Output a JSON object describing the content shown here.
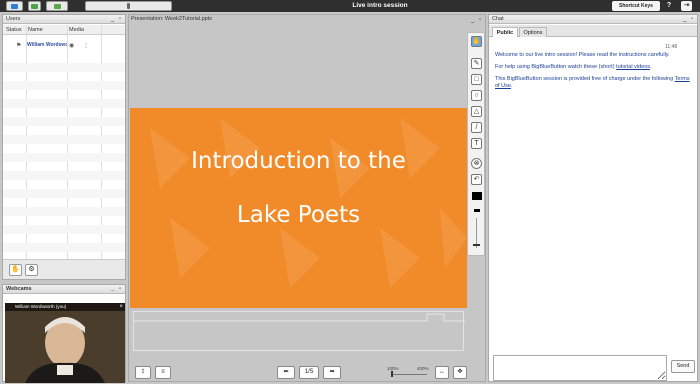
{
  "topbar": {
    "title": "Live intro session",
    "shortcut_label": "Shortcut Keys",
    "help_label": "?",
    "logout_label": "⇥"
  },
  "users": {
    "title": "Users",
    "columns": [
      "Status",
      "Name",
      "Media"
    ],
    "rows": [
      {
        "name": "William Wordsworth"
      }
    ]
  },
  "webcams": {
    "title": "Webcams",
    "caption": "William Wordsworth (you)"
  },
  "presentation": {
    "title": "Presentation: Week2Tutorial.pptx",
    "slide_line1": "Introduction to  the",
    "slide_line2": "Lake Poets",
    "page_indicator": "1/5",
    "zoom_min": "100%",
    "zoom_max": "400%"
  },
  "chat": {
    "title": "Chat",
    "tab_public": "Public",
    "tab_options": "Options",
    "time": "11:48",
    "msg1": "Welcome to our live intro session! Please read the instructions carefully.",
    "msg2_pre": "For help using BigBlueButton watch these (short) ",
    "msg2_link": "tutorial videos",
    "msg2_post": ".",
    "msg3_pre": "This BigBlueButton session is provided free of charge under the following ",
    "msg3_link": "Terms of Use",
    "msg3_post": ".",
    "send_label": "Send"
  },
  "colors": {
    "accent_slide": "#f18b2a",
    "topbar": "#2f2f2f",
    "link": "#1a3f97"
  }
}
